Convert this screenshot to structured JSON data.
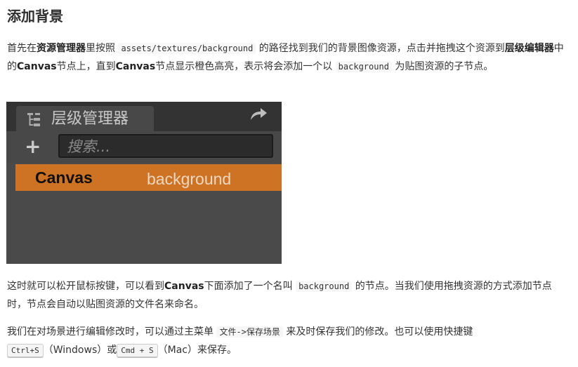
{
  "heading": "添加背景",
  "para1": {
    "t1": "首先在",
    "b1": "资源管理器",
    "t2": "里按照",
    "c1": "assets/textures/background",
    "t3": "的路径找到我们的背景图像资源，点击并拖拽这个资源到",
    "b2": "层级编辑器",
    "t4": "中的",
    "b3": "Canvas",
    "t5": "节点上，直到",
    "b4": "Canvas",
    "t6": "节点显示橙色高亮，表示将会添加一个以",
    "c2": "background",
    "t7": "为贴图资源的子节点。"
  },
  "panel": {
    "tab_label": "层级管理器",
    "search_placeholder": "搜索...",
    "add_glyph": "+",
    "row_name": "Canvas",
    "drag_label": "background",
    "colors": {
      "highlight": "#ce7324",
      "background": "#4a4a4a"
    },
    "icons": [
      "hierarchy-icon",
      "share-icon",
      "add-icon"
    ]
  },
  "para2": {
    "t1": "这时就可以松开鼠标按键，可以看到",
    "b1": "Canvas",
    "t2": "下面添加了一个名叫",
    "c1": "background",
    "t3": "的节点。当我们使用拖拽资源的方式添加节点时，节点会自动以贴图资源的文件名来命名。"
  },
  "para3": {
    "t1": "我们在对场景进行编辑修改时，可以通过主菜单",
    "c1": "文件->保存场景",
    "t2": "来及时保存我们的修改。也可以使用快捷键",
    "k1": "Ctrl+S",
    "t3": "（Windows）或",
    "k2": "Cmd + S",
    "t4": "（Mac）来保存。"
  }
}
